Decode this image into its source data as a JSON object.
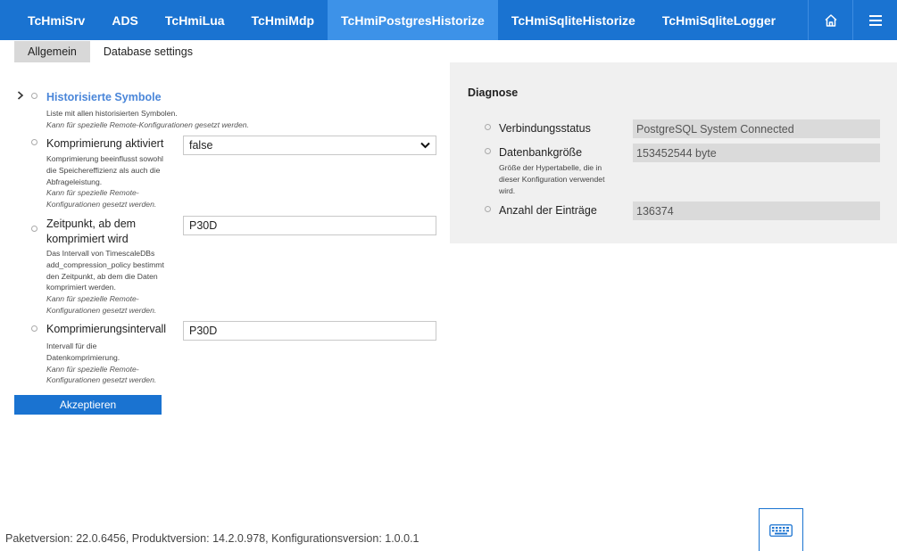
{
  "nav": {
    "tabs": [
      {
        "label": "TcHmiSrv"
      },
      {
        "label": "ADS"
      },
      {
        "label": "TcHmiLua"
      },
      {
        "label": "TcHmiMdp"
      },
      {
        "label": "TcHmiPostgresHistorize",
        "active": true
      },
      {
        "label": "TcHmiSqliteHistorize"
      },
      {
        "label": "TcHmiSqliteLogger"
      }
    ],
    "icons": [
      "home-icon",
      "menu-icon"
    ]
  },
  "subtabs": [
    {
      "label": "Allgemein",
      "active": true
    },
    {
      "label": "Database settings"
    }
  ],
  "form": {
    "historized_symbols": {
      "label": "Historisierte Symbole",
      "desc": "Liste mit allen historisierten Symbolen.",
      "remote_note": "Kann für spezielle Remote-Konfigurationen gesetzt werden."
    },
    "compression_enabled": {
      "label": "Komprimierung aktiviert",
      "desc_lines": [
        "Komprimierung beeinflusst sowohl",
        "die Speichereffizienz als auch die",
        "Abfrageleistung."
      ],
      "remote_lines": [
        "Kann für spezielle Remote-",
        "Konfigurationen gesetzt werden."
      ],
      "value": "false"
    },
    "compress_after": {
      "label_lines": [
        "Zeitpunkt, ab dem",
        "komprimiert wird"
      ],
      "desc_lines": [
        "Das Intervall von TimescaleDBs",
        "add_compression_policy bestimmt",
        "den Zeitpunkt, ab dem die Daten",
        "komprimiert werden."
      ],
      "remote_lines": [
        "Kann für spezielle Remote-",
        "Konfigurationen gesetzt werden."
      ],
      "value": "P30D"
    },
    "compression_interval": {
      "label": "Komprimierungsintervall",
      "desc_lines": [
        "Intervall für die",
        "Datenkomprimierung."
      ],
      "remote_lines": [
        "Kann für spezielle Remote-",
        "Konfigurationen gesetzt werden."
      ],
      "value": "P30D"
    },
    "accept_label": "Akzeptieren"
  },
  "diagnostics": {
    "title": "Diagnose",
    "connection": {
      "label": "Verbindungsstatus",
      "value": "PostgreSQL System Connected"
    },
    "db_size": {
      "label": "Datenbankgröße",
      "value": "153452544 byte",
      "desc_lines": [
        "Größe der Hypertabelle, die in",
        "dieser Konfiguration verwendet",
        "wird."
      ]
    },
    "entries": {
      "label": "Anzahl der Einträge",
      "value": "136374"
    }
  },
  "footer": {
    "version_text": "Paketversion: 22.0.6456, Produktversion: 14.2.0.978, Konfigurationsversion: 1.0.0.1"
  },
  "colors": {
    "accent": "#1a73d1",
    "active_tab": "#3d92e8",
    "link": "#4a86d9",
    "panel_bg": "#f0f0f0"
  }
}
